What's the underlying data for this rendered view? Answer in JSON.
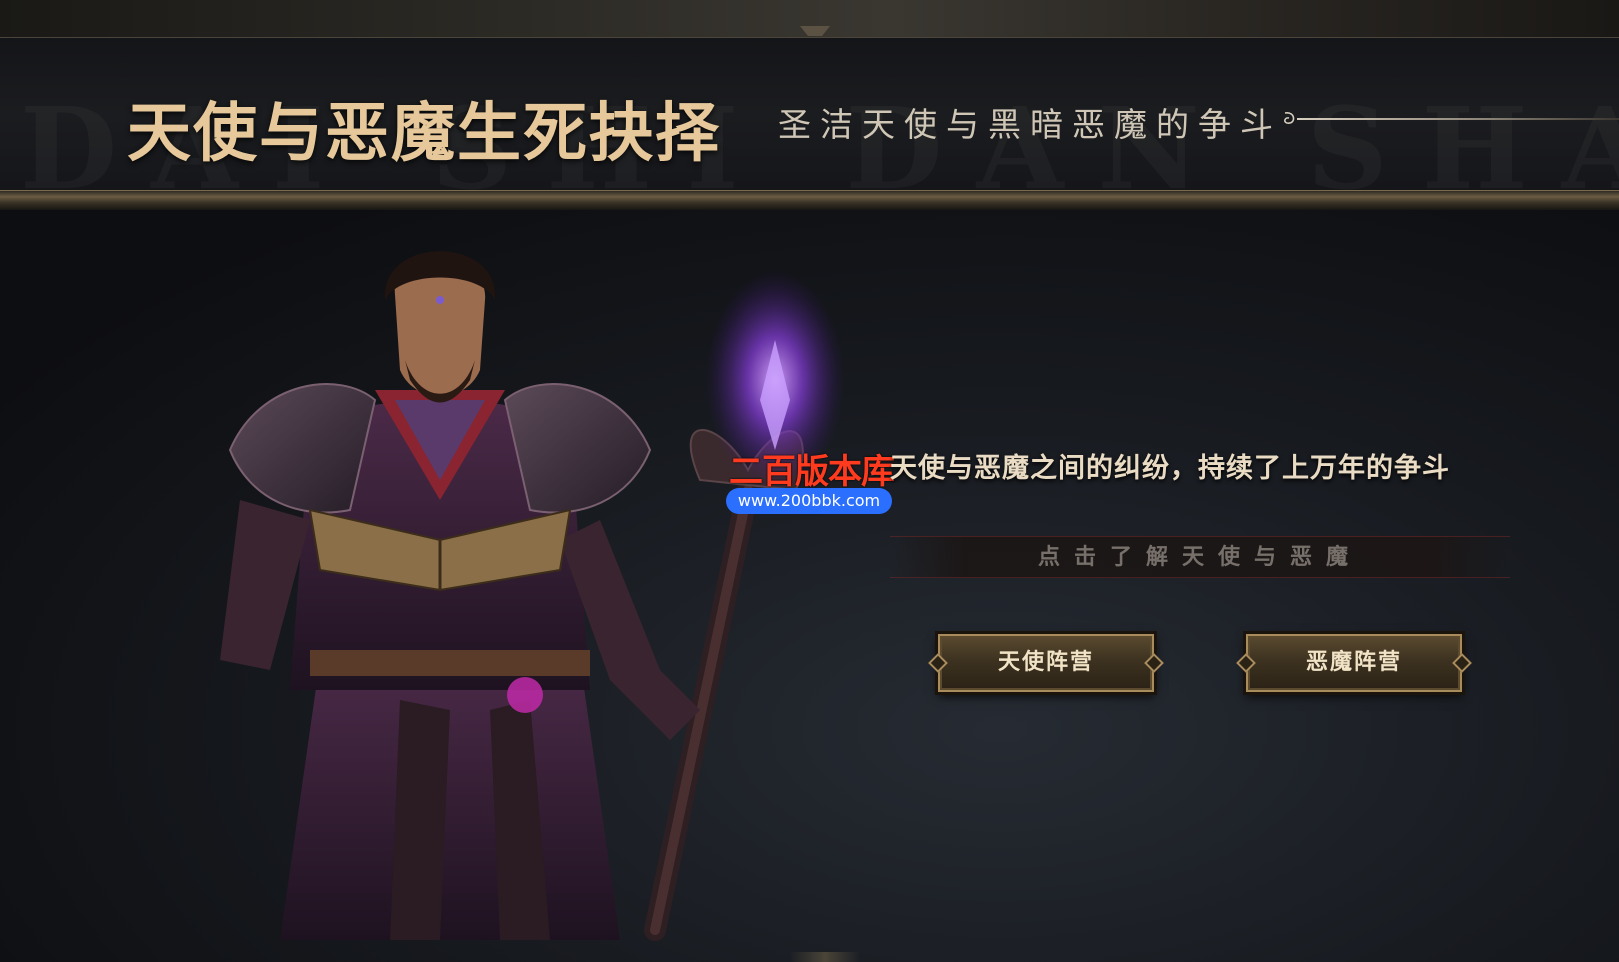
{
  "header": {
    "title": "天使与恶魔生死抉择",
    "subtitle": "圣洁天使与黑暗恶魔的争斗",
    "watermark_text": "DAI SHI DAN SHAI"
  },
  "main": {
    "tagline": "天使与恶魔之间的纠纷，持续了上万年的争斗",
    "learn_more_label": "点击了解天使与恶魔",
    "camps": {
      "angel_label": "天使阵营",
      "demon_label": "恶魔阵营"
    }
  },
  "site_watermark": {
    "name": "二百版本库",
    "url": "www.200bbk.com"
  },
  "colors": {
    "title_gold": "#e6c89a",
    "button_border": "#a88c5c",
    "watermark_red": "#ff3b1f",
    "watermark_blue": "#2b6fff",
    "staff_glow": "#a35cff"
  },
  "icons": {
    "line_end": "swirl-icon"
  }
}
